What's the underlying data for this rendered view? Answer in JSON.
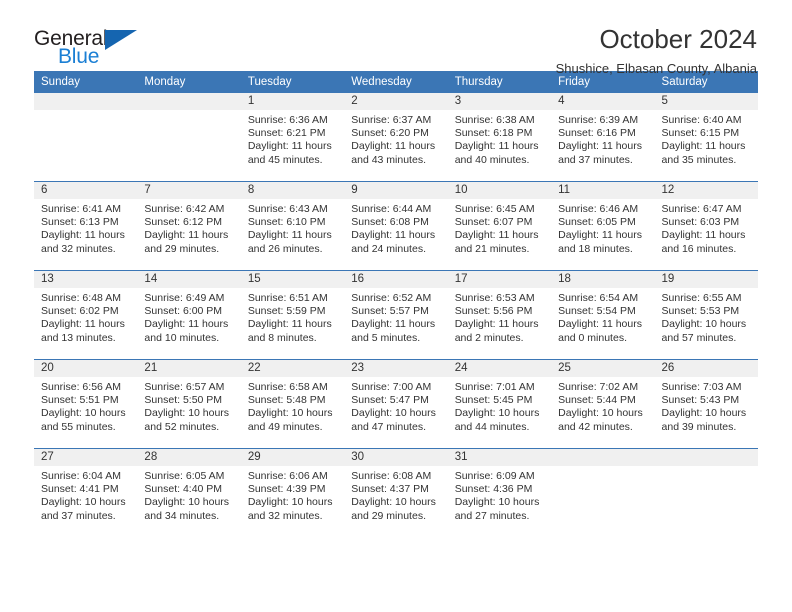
{
  "brand": {
    "name_top": "General",
    "name_bottom": "Blue",
    "triangle_color": "#1565b0",
    "blue_text_color": "#1b7fd4"
  },
  "header": {
    "title": "October 2024",
    "subtitle": "Shushice, Elbasan County, Albania"
  },
  "theme": {
    "header_blue": "#3b76b5",
    "daynum_band": "#f0f0f0",
    "text": "#333333"
  },
  "labels": {
    "sunrise_prefix": "Sunrise:",
    "sunset_prefix": "Sunset:",
    "daylight_prefix": "Daylight:"
  },
  "weekdays": [
    "Sunday",
    "Monday",
    "Tuesday",
    "Wednesday",
    "Thursday",
    "Friday",
    "Saturday"
  ],
  "weeks": [
    [
      {
        "day": "",
        "sunrise": "",
        "sunset": "",
        "daylight_line1": "",
        "daylight_line2": ""
      },
      {
        "day": "",
        "sunrise": "",
        "sunset": "",
        "daylight_line1": "",
        "daylight_line2": ""
      },
      {
        "day": "1",
        "sunrise": "Sunrise: 6:36 AM",
        "sunset": "Sunset: 6:21 PM",
        "daylight_line1": "Daylight: 11 hours",
        "daylight_line2": "and 45 minutes."
      },
      {
        "day": "2",
        "sunrise": "Sunrise: 6:37 AM",
        "sunset": "Sunset: 6:20 PM",
        "daylight_line1": "Daylight: 11 hours",
        "daylight_line2": "and 43 minutes."
      },
      {
        "day": "3",
        "sunrise": "Sunrise: 6:38 AM",
        "sunset": "Sunset: 6:18 PM",
        "daylight_line1": "Daylight: 11 hours",
        "daylight_line2": "and 40 minutes."
      },
      {
        "day": "4",
        "sunrise": "Sunrise: 6:39 AM",
        "sunset": "Sunset: 6:16 PM",
        "daylight_line1": "Daylight: 11 hours",
        "daylight_line2": "and 37 minutes."
      },
      {
        "day": "5",
        "sunrise": "Sunrise: 6:40 AM",
        "sunset": "Sunset: 6:15 PM",
        "daylight_line1": "Daylight: 11 hours",
        "daylight_line2": "and 35 minutes."
      }
    ],
    [
      {
        "day": "6",
        "sunrise": "Sunrise: 6:41 AM",
        "sunset": "Sunset: 6:13 PM",
        "daylight_line1": "Daylight: 11 hours",
        "daylight_line2": "and 32 minutes."
      },
      {
        "day": "7",
        "sunrise": "Sunrise: 6:42 AM",
        "sunset": "Sunset: 6:12 PM",
        "daylight_line1": "Daylight: 11 hours",
        "daylight_line2": "and 29 minutes."
      },
      {
        "day": "8",
        "sunrise": "Sunrise: 6:43 AM",
        "sunset": "Sunset: 6:10 PM",
        "daylight_line1": "Daylight: 11 hours",
        "daylight_line2": "and 26 minutes."
      },
      {
        "day": "9",
        "sunrise": "Sunrise: 6:44 AM",
        "sunset": "Sunset: 6:08 PM",
        "daylight_line1": "Daylight: 11 hours",
        "daylight_line2": "and 24 minutes."
      },
      {
        "day": "10",
        "sunrise": "Sunrise: 6:45 AM",
        "sunset": "Sunset: 6:07 PM",
        "daylight_line1": "Daylight: 11 hours",
        "daylight_line2": "and 21 minutes."
      },
      {
        "day": "11",
        "sunrise": "Sunrise: 6:46 AM",
        "sunset": "Sunset: 6:05 PM",
        "daylight_line1": "Daylight: 11 hours",
        "daylight_line2": "and 18 minutes."
      },
      {
        "day": "12",
        "sunrise": "Sunrise: 6:47 AM",
        "sunset": "Sunset: 6:03 PM",
        "daylight_line1": "Daylight: 11 hours",
        "daylight_line2": "and 16 minutes."
      }
    ],
    [
      {
        "day": "13",
        "sunrise": "Sunrise: 6:48 AM",
        "sunset": "Sunset: 6:02 PM",
        "daylight_line1": "Daylight: 11 hours",
        "daylight_line2": "and 13 minutes."
      },
      {
        "day": "14",
        "sunrise": "Sunrise: 6:49 AM",
        "sunset": "Sunset: 6:00 PM",
        "daylight_line1": "Daylight: 11 hours",
        "daylight_line2": "and 10 minutes."
      },
      {
        "day": "15",
        "sunrise": "Sunrise: 6:51 AM",
        "sunset": "Sunset: 5:59 PM",
        "daylight_line1": "Daylight: 11 hours",
        "daylight_line2": "and 8 minutes."
      },
      {
        "day": "16",
        "sunrise": "Sunrise: 6:52 AM",
        "sunset": "Sunset: 5:57 PM",
        "daylight_line1": "Daylight: 11 hours",
        "daylight_line2": "and 5 minutes."
      },
      {
        "day": "17",
        "sunrise": "Sunrise: 6:53 AM",
        "sunset": "Sunset: 5:56 PM",
        "daylight_line1": "Daylight: 11 hours",
        "daylight_line2": "and 2 minutes."
      },
      {
        "day": "18",
        "sunrise": "Sunrise: 6:54 AM",
        "sunset": "Sunset: 5:54 PM",
        "daylight_line1": "Daylight: 11 hours",
        "daylight_line2": "and 0 minutes."
      },
      {
        "day": "19",
        "sunrise": "Sunrise: 6:55 AM",
        "sunset": "Sunset: 5:53 PM",
        "daylight_line1": "Daylight: 10 hours",
        "daylight_line2": "and 57 minutes."
      }
    ],
    [
      {
        "day": "20",
        "sunrise": "Sunrise: 6:56 AM",
        "sunset": "Sunset: 5:51 PM",
        "daylight_line1": "Daylight: 10 hours",
        "daylight_line2": "and 55 minutes."
      },
      {
        "day": "21",
        "sunrise": "Sunrise: 6:57 AM",
        "sunset": "Sunset: 5:50 PM",
        "daylight_line1": "Daylight: 10 hours",
        "daylight_line2": "and 52 minutes."
      },
      {
        "day": "22",
        "sunrise": "Sunrise: 6:58 AM",
        "sunset": "Sunset: 5:48 PM",
        "daylight_line1": "Daylight: 10 hours",
        "daylight_line2": "and 49 minutes."
      },
      {
        "day": "23",
        "sunrise": "Sunrise: 7:00 AM",
        "sunset": "Sunset: 5:47 PM",
        "daylight_line1": "Daylight: 10 hours",
        "daylight_line2": "and 47 minutes."
      },
      {
        "day": "24",
        "sunrise": "Sunrise: 7:01 AM",
        "sunset": "Sunset: 5:45 PM",
        "daylight_line1": "Daylight: 10 hours",
        "daylight_line2": "and 44 minutes."
      },
      {
        "day": "25",
        "sunrise": "Sunrise: 7:02 AM",
        "sunset": "Sunset: 5:44 PM",
        "daylight_line1": "Daylight: 10 hours",
        "daylight_line2": "and 42 minutes."
      },
      {
        "day": "26",
        "sunrise": "Sunrise: 7:03 AM",
        "sunset": "Sunset: 5:43 PM",
        "daylight_line1": "Daylight: 10 hours",
        "daylight_line2": "and 39 minutes."
      }
    ],
    [
      {
        "day": "27",
        "sunrise": "Sunrise: 6:04 AM",
        "sunset": "Sunset: 4:41 PM",
        "daylight_line1": "Daylight: 10 hours",
        "daylight_line2": "and 37 minutes."
      },
      {
        "day": "28",
        "sunrise": "Sunrise: 6:05 AM",
        "sunset": "Sunset: 4:40 PM",
        "daylight_line1": "Daylight: 10 hours",
        "daylight_line2": "and 34 minutes."
      },
      {
        "day": "29",
        "sunrise": "Sunrise: 6:06 AM",
        "sunset": "Sunset: 4:39 PM",
        "daylight_line1": "Daylight: 10 hours",
        "daylight_line2": "and 32 minutes."
      },
      {
        "day": "30",
        "sunrise": "Sunrise: 6:08 AM",
        "sunset": "Sunset: 4:37 PM",
        "daylight_line1": "Daylight: 10 hours",
        "daylight_line2": "and 29 minutes."
      },
      {
        "day": "31",
        "sunrise": "Sunrise: 6:09 AM",
        "sunset": "Sunset: 4:36 PM",
        "daylight_line1": "Daylight: 10 hours",
        "daylight_line2": "and 27 minutes."
      },
      {
        "day": "",
        "sunrise": "",
        "sunset": "",
        "daylight_line1": "",
        "daylight_line2": ""
      },
      {
        "day": "",
        "sunrise": "",
        "sunset": "",
        "daylight_line1": "",
        "daylight_line2": ""
      }
    ]
  ]
}
